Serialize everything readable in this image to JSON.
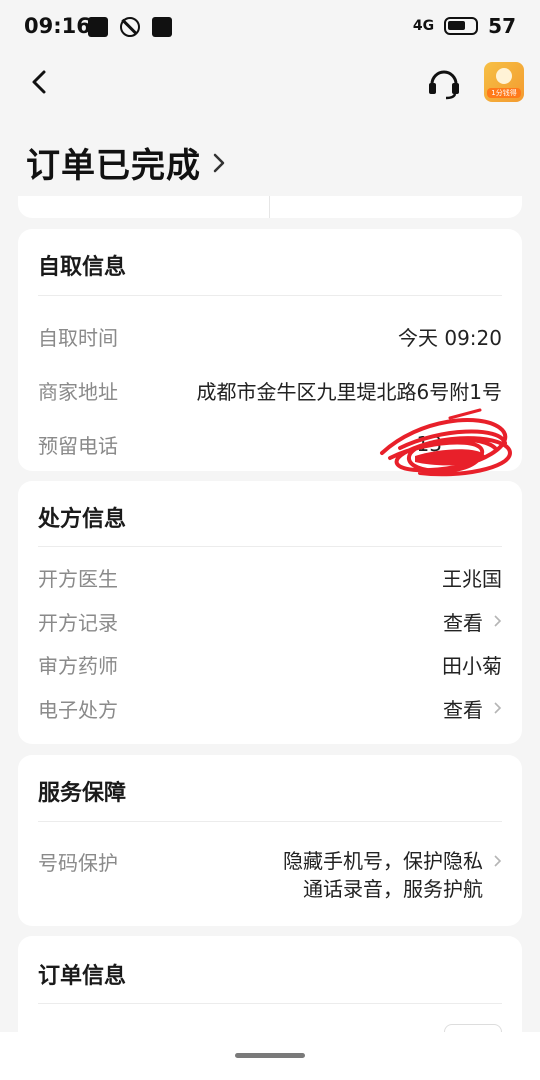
{
  "status_bar": {
    "time": "09:16",
    "network": "4G",
    "battery": "57",
    "icons_left": [
      "gallery-icon",
      "do-not-disturb-icon",
      "upload-icon"
    ]
  },
  "nav": {
    "back_icon": "chevron-left-icon",
    "support_icon": "headset-icon",
    "mascot_badge": "1分钱得"
  },
  "page_title": "订单已完成",
  "pickup": {
    "title": "自取信息",
    "rows": [
      {
        "label": "自取时间",
        "value": "今天 09:20"
      },
      {
        "label": "商家地址",
        "value": "成都市金牛区九里堤北路6号附1号"
      },
      {
        "label": "预留电话",
        "value": "13"
      }
    ]
  },
  "prescription": {
    "title": "处方信息",
    "rows": [
      {
        "label": "开方医生",
        "value": "王兆国"
      },
      {
        "label": "开方记录",
        "value": "查看"
      },
      {
        "label": "审方药师",
        "value": "田小菊"
      },
      {
        "label": "电子处方",
        "value": "查看"
      }
    ]
  },
  "service": {
    "title": "服务保障",
    "row_label": "号码保护",
    "line1": "隐藏手机号，保护隐私",
    "line2": "通话录音，服务护航"
  },
  "order": {
    "title": "订单信息"
  },
  "colors": {
    "background": "#f5f5f5",
    "card": "#ffffff",
    "label": "#8a8a8a",
    "scribble": "#e8202a"
  }
}
